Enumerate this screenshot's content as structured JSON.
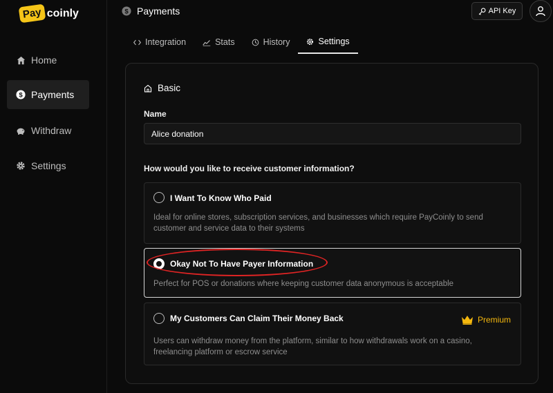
{
  "logo": {
    "badge": "Pay",
    "text": "coinly"
  },
  "sidebar": {
    "items": [
      {
        "label": "Home",
        "icon": "home-icon"
      },
      {
        "label": "Payments",
        "icon": "dollar-icon"
      },
      {
        "label": "Withdraw",
        "icon": "piggy-bank-icon"
      },
      {
        "label": "Settings",
        "icon": "gear-icon"
      }
    ]
  },
  "header": {
    "title": "Payments",
    "api_key_label": "API Key"
  },
  "tabs": [
    {
      "label": "Integration",
      "icon": "code-icon"
    },
    {
      "label": "Stats",
      "icon": "chart-line-icon"
    },
    {
      "label": "History",
      "icon": "history-icon"
    },
    {
      "label": "Settings",
      "icon": "gear-icon"
    }
  ],
  "form": {
    "section_title": "Basic",
    "name_label": "Name",
    "name_value": "Alice donation",
    "question": "How would you like to receive customer information?",
    "options": [
      {
        "title": "I Want To Know Who Paid",
        "desc": "Ideal for online stores, subscription services, and businesses which require PayCoinly to send customer and service data to their systems",
        "selected": false
      },
      {
        "title": "Okay Not To Have Payer Information",
        "desc": "Perfect for POS or donations where keeping customer data anonymous is acceptable",
        "selected": true
      },
      {
        "title": "My Customers Can Claim Their Money Back",
        "desc": "Users can withdraw money from the platform, similar to how withdrawals work on a casino, freelancing platform or escrow service",
        "selected": false,
        "badge": "Premium"
      }
    ]
  },
  "colors": {
    "premium": "#f5b80e",
    "highlight": "#e02424"
  }
}
